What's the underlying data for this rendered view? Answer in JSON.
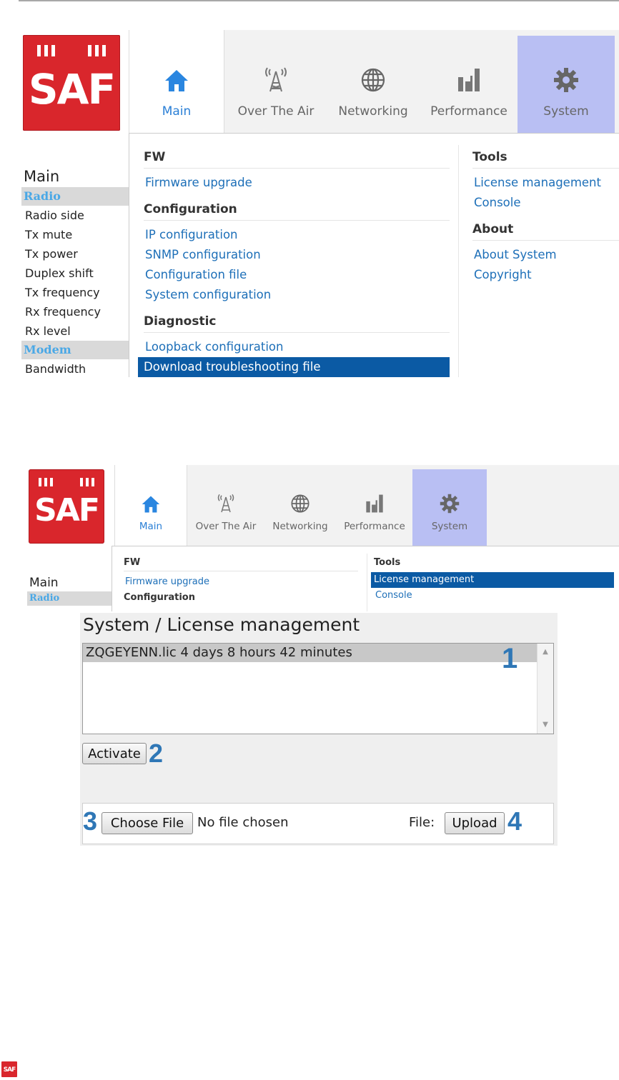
{
  "brand": {
    "logo_text": "SAF",
    "accent": "#d9262c",
    "link": "#1d6fb8",
    "selected": "#0b5aa4",
    "system_tab": "#b9bff3"
  },
  "nav": {
    "main": {
      "label": "Main",
      "icon": "home-icon"
    },
    "ota": {
      "label": "Over The Air",
      "icon": "antenna-tower-icon"
    },
    "net": {
      "label": "Networking",
      "icon": "globe-icon"
    },
    "perf": {
      "label": "Performance",
      "icon": "bar-chart-icon"
    },
    "sys": {
      "label": "System",
      "icon": "gear-icon"
    }
  },
  "sidebar": {
    "title": "Main",
    "radio_label": "Radio",
    "items": [
      "Radio side",
      "Tx mute",
      "Tx power",
      "Duplex shift",
      "Tx frequency",
      "Rx frequency",
      "Rx level"
    ],
    "modem_label": "Modem",
    "clipped_item": "Bandwidth"
  },
  "menu": {
    "fw_header": "FW",
    "fw_upgrade": "Firmware upgrade",
    "config_header": "Configuration",
    "ip_config": "IP configuration",
    "snmp_config": "SNMP configuration",
    "config_file": "Configuration file",
    "system_config": "System configuration",
    "diag_header": "Diagnostic",
    "loopback": "Loopback configuration",
    "troubleshoot": "Download troubleshooting file",
    "tools_header": "Tools",
    "license_mgmt": "License management",
    "console": "Console",
    "about_header": "About",
    "about_system": "About System",
    "copyright": "Copyright"
  },
  "license_page": {
    "title": "System / License management",
    "license_entry": "ZQGEYENN.lic 4 days 8 hours 42 minutes",
    "activate_label": "Activate",
    "choose_file_label": "Choose File",
    "no_file_text": "No file chosen",
    "file_label": "File:",
    "upload_label": "Upload",
    "markers": [
      "1",
      "2",
      "3",
      "4"
    ]
  }
}
